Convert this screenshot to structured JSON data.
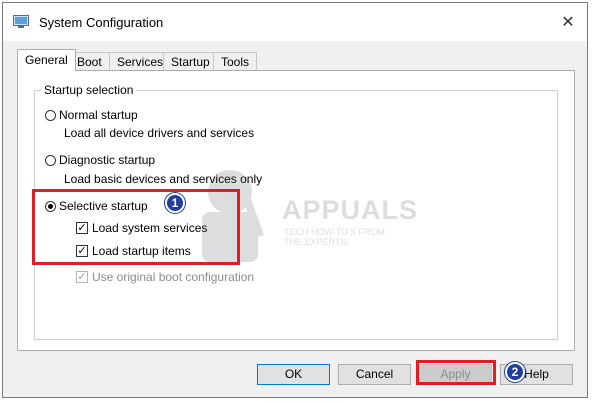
{
  "window": {
    "title": "System Configuration",
    "close_glyph": "✕"
  },
  "tabs": [
    "General",
    "Boot",
    "Services",
    "Startup",
    "Tools"
  ],
  "startup_selection": {
    "legend": "Startup selection",
    "normal": {
      "label": "Normal startup",
      "desc": "Load all device drivers and services",
      "selected": false
    },
    "diagnostic": {
      "label": "Diagnostic startup",
      "desc": "Load basic devices and services only",
      "selected": false
    },
    "selective": {
      "label": "Selective startup",
      "selected": true,
      "options": [
        {
          "label": "Load system services",
          "checked": true,
          "enabled": true
        },
        {
          "label": "Load startup items",
          "checked": true,
          "enabled": true
        },
        {
          "label": "Use original boot configuration",
          "checked": true,
          "enabled": false
        }
      ]
    }
  },
  "buttons": {
    "ok": "OK",
    "cancel": "Cancel",
    "apply": "Apply",
    "help": "Help"
  },
  "annotations": {
    "badge1": "1",
    "badge2": "2",
    "highlight_color": "#e21c24",
    "badge_color": "#1f3e9e"
  },
  "watermark": {
    "brand": "APPUALS",
    "tagline_1": "TECH HOW-TO'S FROM",
    "tagline_2": "THE EXPERTS!"
  },
  "check_glyph": "✓"
}
